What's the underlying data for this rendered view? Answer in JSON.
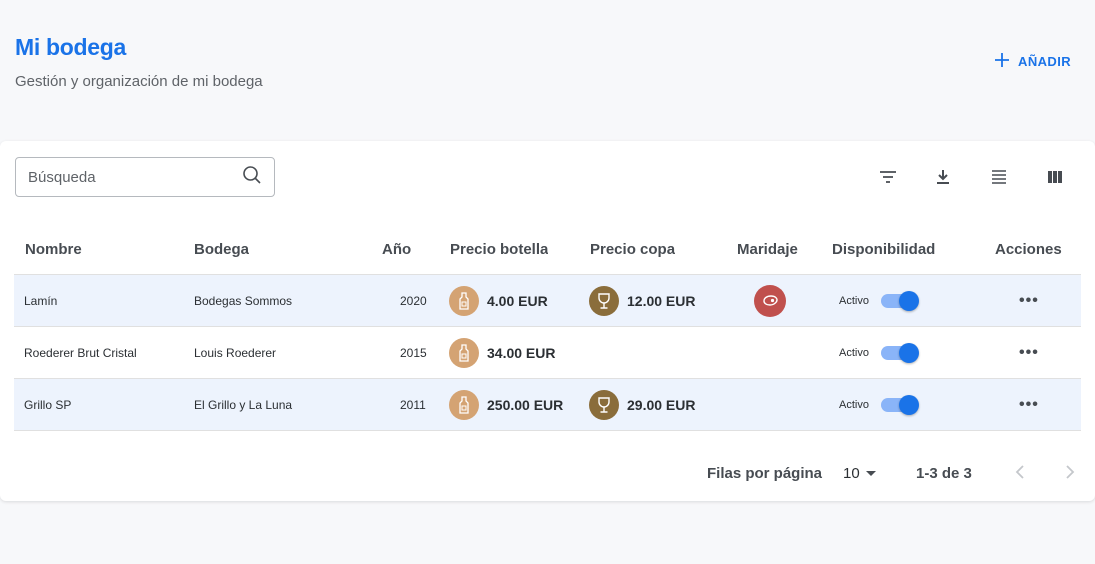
{
  "header": {
    "title": "Mi bodega",
    "subtitle": "Gestión y organización de mi bodega",
    "add_label": "AÑADIR"
  },
  "search": {
    "placeholder": "Búsqueda"
  },
  "toolbar": {
    "icons": [
      "filter-icon",
      "download-icon",
      "density-icon",
      "columns-icon"
    ]
  },
  "table": {
    "columns": [
      "Nombre",
      "Bodega",
      "Año",
      "Precio botella",
      "Precio copa",
      "Maridaje",
      "Disponibilidad",
      "Acciones"
    ],
    "rows": [
      {
        "name": "Lamín",
        "winery": "Bodegas Sommos",
        "year": "2020",
        "bottle_price": "4.00 EUR",
        "glass_price": "12.00 EUR",
        "pairing": "meat-icon",
        "availability": "Activo",
        "active": true,
        "actions": "•••"
      },
      {
        "name": "Roederer Brut Cristal",
        "winery": "Louis Roederer",
        "year": "2015",
        "bottle_price": "34.00 EUR",
        "glass_price": "",
        "pairing": "",
        "availability": "Activo",
        "active": true,
        "actions": "•••"
      },
      {
        "name": "Grillo SP",
        "winery": "El Grillo y La Luna",
        "year": "2011",
        "bottle_price": "250.00 EUR",
        "glass_price": "29.00 EUR",
        "pairing": "",
        "availability": "Activo",
        "active": true,
        "actions": "•••"
      }
    ]
  },
  "pagination": {
    "rows_label": "Filas por página",
    "rows_per_page": "10",
    "range": "1-3 de 3"
  },
  "colors": {
    "accent": "#1a73e8",
    "bottle_icon_bg": "#d4a373",
    "glass_icon_bg": "#8a6d3b",
    "pairing_icon_bg": "#c0504d",
    "row_highlight": "#edf3fd"
  }
}
